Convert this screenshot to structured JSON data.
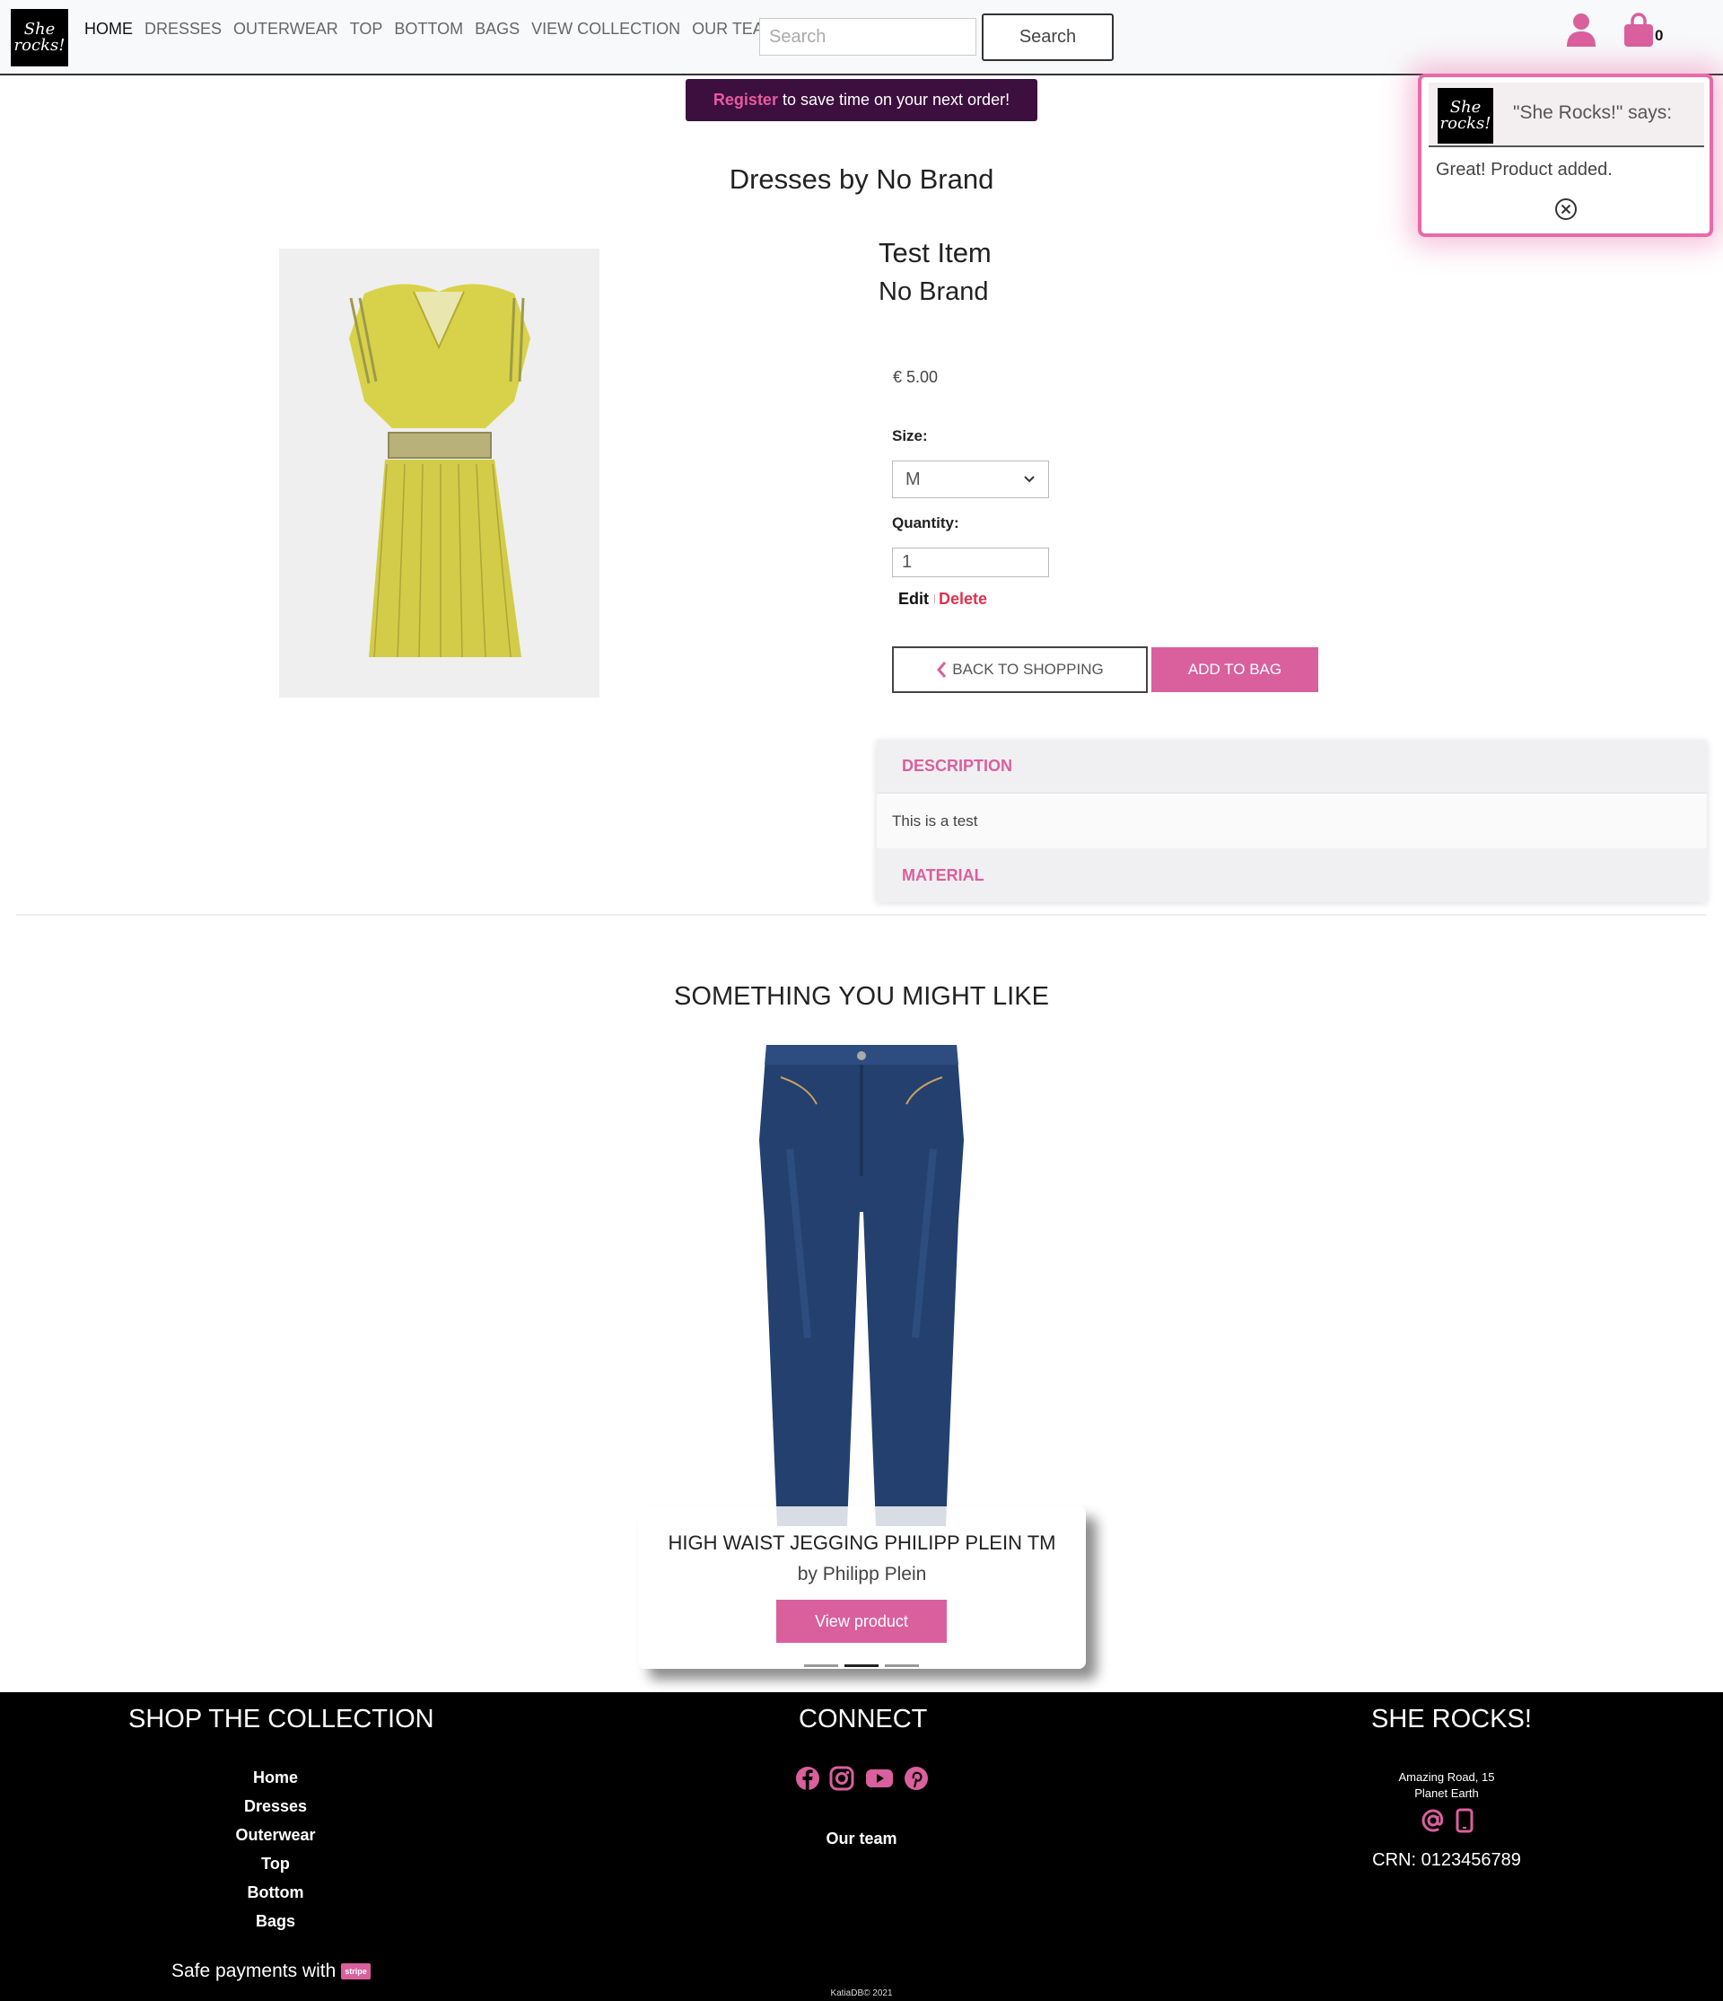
{
  "nav": {
    "logo_text": "She rocks!",
    "links": [
      "HOME",
      "DRESSES",
      "OUTERWEAR",
      "TOP",
      "BOTTOM",
      "BAGS",
      "VIEW COLLECTION",
      "OUR TEAM"
    ],
    "search_placeholder": "Search",
    "search_button": "Search",
    "bag_count": "0",
    "user_icon": "user-icon",
    "bag_icon": "shopping-bag-icon"
  },
  "banner": {
    "link": "Register",
    "text": "to save time on your next order!"
  },
  "toast": {
    "title": "\"She Rocks!\" says:",
    "message": "Great! Product added.",
    "close_icon": "close-circle-icon"
  },
  "product": {
    "heading": "Dresses by No Brand",
    "name": "Test Item",
    "brand": "No Brand",
    "price": "€ 5.00",
    "size_label": "Size:",
    "size_value": "M",
    "quantity_label": "Quantity:",
    "quantity_value": "1",
    "edit": "Edit",
    "separator": "|",
    "delete": "Delete",
    "back_button": "BACK TO SHOPPING",
    "add_button": "ADD TO BAG"
  },
  "accordion": {
    "description_title": "DESCRIPTION",
    "description_body": "This is a test",
    "material_title": "MATERIAL"
  },
  "recommendation": {
    "heading": "SOMETHING YOU MIGHT LIKE",
    "title": "HIGH WAIST JEGGING PHILIPP PLEIN TM",
    "by": "by Philipp Plein",
    "button": "View product",
    "active_slide": 2,
    "slide_count": 3
  },
  "footer": {
    "shop_title": "SHOP THE COLLECTION",
    "shop_links": [
      "Home",
      "Dresses",
      "Outerwear",
      "Top",
      "Bottom",
      "Bags"
    ],
    "safe_payments": "Safe payments with",
    "stripe": "stripe",
    "connect_title": "CONNECT",
    "social_icons": [
      "facebook-icon",
      "instagram-icon",
      "youtube-icon",
      "pinterest-icon"
    ],
    "our_team": "Our team",
    "brand_title": "SHE ROCKS!",
    "address_line1": "Amazing Road, 15",
    "address_line2": "Planet Earth",
    "crn": "CRN: 0123456789",
    "copyright": "KatiaDB© 2021"
  },
  "colors": {
    "accent": "#d9609d",
    "banner_bg": "#3c0f3e",
    "footer_bg": "#000000",
    "delete": "#e03050"
  }
}
